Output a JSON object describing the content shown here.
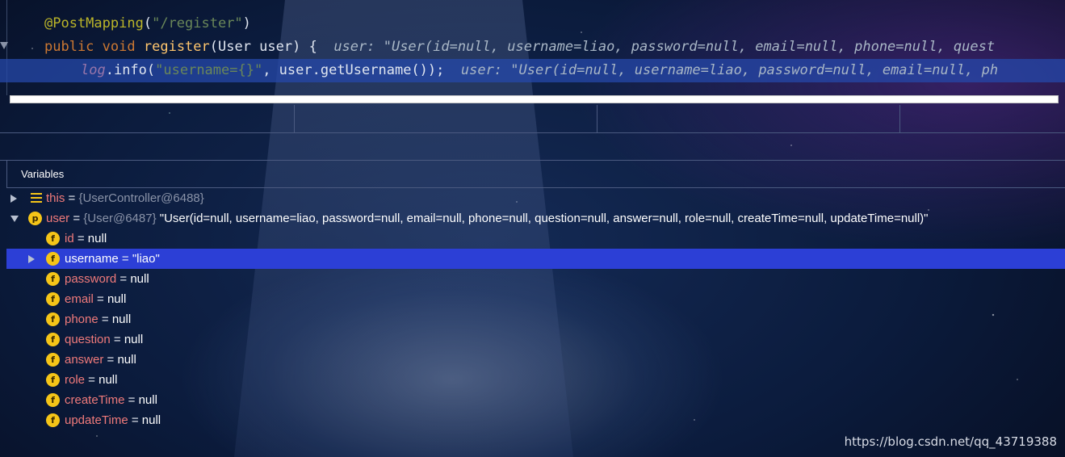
{
  "editor": {
    "line1": {
      "annotation": "@PostMapping",
      "paren_open": "(",
      "string": "\"/register\"",
      "paren_close": ")"
    },
    "line2": {
      "kw1": "public",
      "kw2": "void",
      "method": "register",
      "sig": "(User user) {",
      "hint": "user: \"User(id=null, username=liao, password=null, email=null, phone=null, quest"
    },
    "line3": {
      "log": "log",
      "dot_info": ".info(",
      "string": "\"username={}\"",
      "rest": ", user.getUsername());",
      "hint": "user: \"User(id=null, username=liao, password=null, email=null, ph"
    }
  },
  "variables_panel": {
    "title": "Variables",
    "this_row": {
      "name": "this",
      "eq": " = ",
      "type": "{UserController@6488}"
    },
    "user_row": {
      "name": "user",
      "eq": " = ",
      "type": "{User@6487}",
      "value": " \"User(id=null, username=liao, password=null, email=null, phone=null, question=null, answer=null, role=null, createTime=null, updateTime=null)\""
    },
    "fields": [
      {
        "icon": "f",
        "name": "id",
        "eq": " = ",
        "value": "null"
      },
      {
        "icon": "f",
        "name": "username",
        "eq": " = ",
        "value": "\"liao\""
      },
      {
        "icon": "f",
        "name": "password",
        "eq": " = ",
        "value": "null"
      },
      {
        "icon": "f",
        "name": "email",
        "eq": " = ",
        "value": "null"
      },
      {
        "icon": "f",
        "name": "phone",
        "eq": " = ",
        "value": "null"
      },
      {
        "icon": "f",
        "name": "question",
        "eq": " = ",
        "value": "null"
      },
      {
        "icon": "f",
        "name": "answer",
        "eq": " = ",
        "value": "null"
      },
      {
        "icon": "f",
        "name": "role",
        "eq": " = ",
        "value": "null"
      },
      {
        "icon": "f",
        "name": "createTime",
        "eq": " = ",
        "value": "null"
      },
      {
        "icon": "f",
        "name": "updateTime",
        "eq": " = ",
        "value": "null"
      }
    ],
    "user_icon": "p"
  },
  "watermark": "https://blog.csdn.net/qq_43719388",
  "colors": {
    "selected_row": "#2c3fd6",
    "current_line": "#2648aa",
    "field_icon": "#f5c518"
  }
}
